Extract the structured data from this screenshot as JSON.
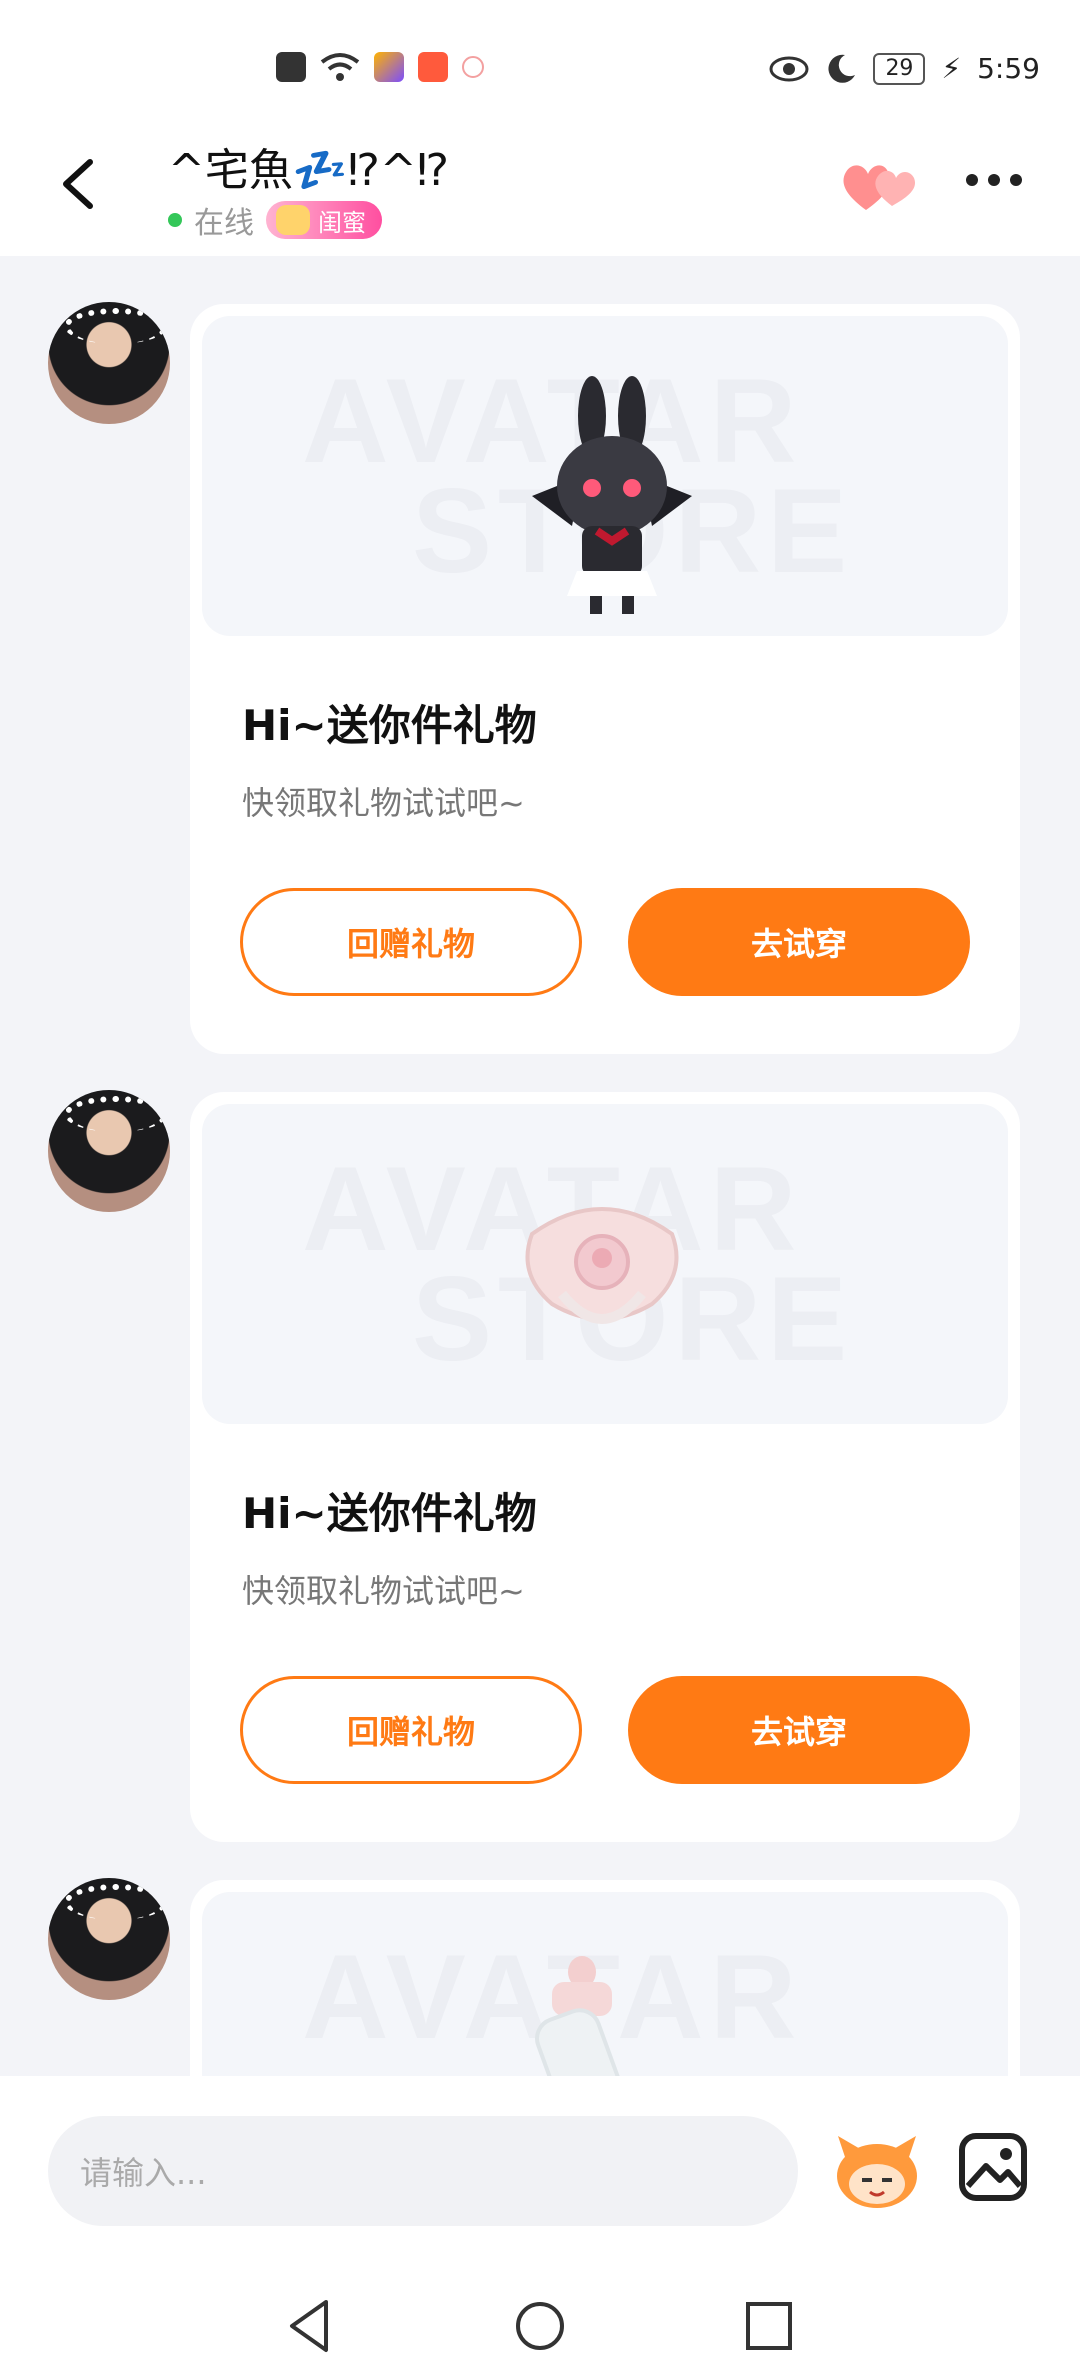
{
  "status": {
    "time": "5:59",
    "battery": "29"
  },
  "header": {
    "title": "^宅魚💤⁉^⁉",
    "online": "在线",
    "tag": "闺蜜"
  },
  "messages": [
    {
      "title": "Hi~送你件礼物",
      "subtitle": "快领取礼物试试吧~",
      "return_button": "回赠礼物",
      "try_button": "去试穿",
      "watermark_line1": "AVATAR",
      "watermark_line2": "STORE",
      "item_icon": "bunny-doll-icon"
    },
    {
      "title": "Hi~送你件礼物",
      "subtitle": "快领取礼物试试吧~",
      "return_button": "回赠礼物",
      "try_button": "去试穿",
      "watermark_line1": "AVATAR",
      "watermark_line2": "STORE",
      "item_icon": "pacifier-icon"
    },
    {
      "watermark_line1": "AVATAR",
      "item_icon": "baby-bottle-icon"
    }
  ],
  "input": {
    "placeholder": "请输入..."
  },
  "colors": {
    "accent": "#ff7a14",
    "online": "#34c759",
    "background": "#f3f4f8"
  }
}
